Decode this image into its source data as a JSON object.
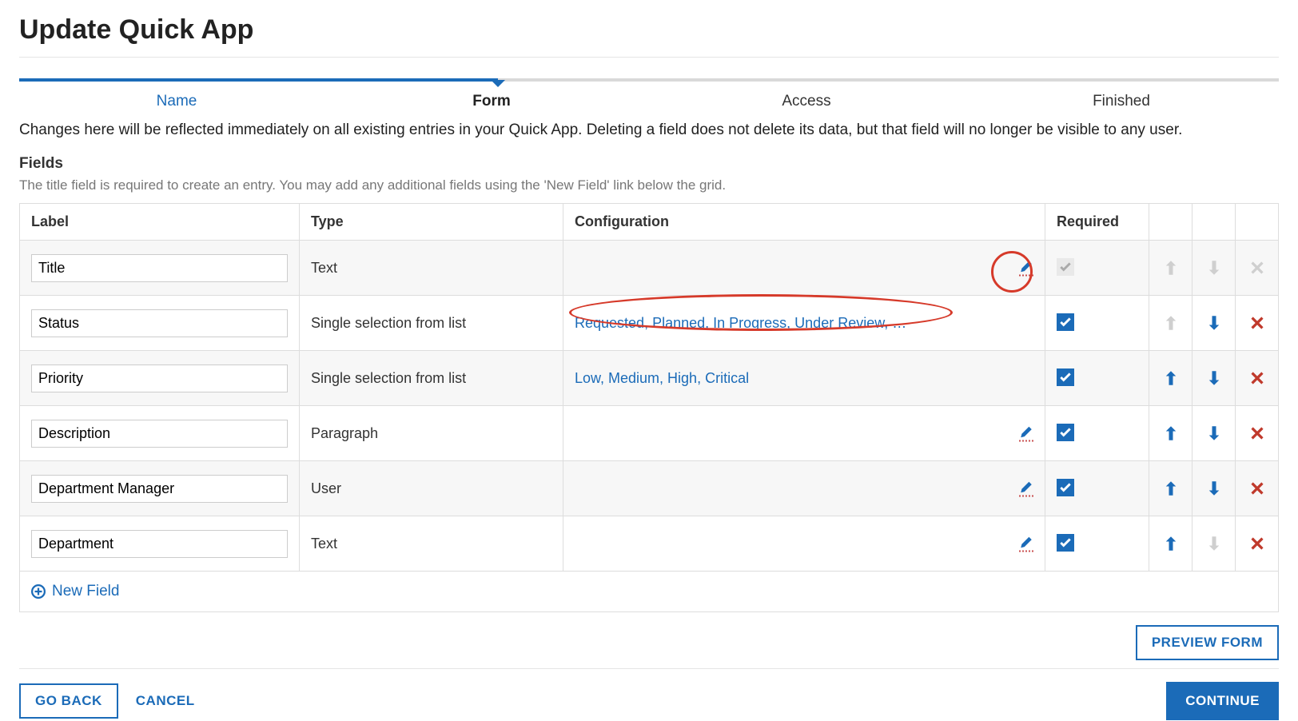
{
  "page": {
    "title": "Update Quick App",
    "intro": "Changes here will be reflected immediately on all existing entries in your Quick App. Deleting a field does not delete its data, but that field will no longer be visible to any user."
  },
  "stepper": {
    "steps": [
      "Name",
      "Form",
      "Access",
      "Finished"
    ],
    "active_index": 1
  },
  "fields_section": {
    "heading": "Fields",
    "sub": "The title field is required to create an entry. You may add any additional fields using the 'New Field' link below the grid."
  },
  "table": {
    "headers": {
      "label": "Label",
      "type": "Type",
      "config": "Configuration",
      "required": "Required"
    },
    "rows": [
      {
        "label": "Title",
        "type": "Text",
        "config_text": "",
        "has_edit_icon": true,
        "required": true,
        "required_locked": true,
        "up_enabled": false,
        "down_enabled": false,
        "delete_enabled": false,
        "highlight_circle": true
      },
      {
        "label": "Status",
        "type": "Single selection from list",
        "config_text": "Requested, Planned, In Progress, Under Review, Co…",
        "has_edit_icon": false,
        "required": true,
        "required_locked": false,
        "up_enabled": false,
        "down_enabled": true,
        "delete_enabled": true,
        "highlight_ellipse": true
      },
      {
        "label": "Priority",
        "type": "Single selection from list",
        "config_text": "Low, Medium, High, Critical",
        "has_edit_icon": false,
        "required": true,
        "required_locked": false,
        "up_enabled": true,
        "down_enabled": true,
        "delete_enabled": true
      },
      {
        "label": "Description",
        "type": "Paragraph",
        "config_text": "",
        "has_edit_icon": true,
        "required": true,
        "required_locked": false,
        "up_enabled": true,
        "down_enabled": true,
        "delete_enabled": true
      },
      {
        "label": "Department Manager",
        "type": "User",
        "config_text": "",
        "has_edit_icon": true,
        "required": true,
        "required_locked": false,
        "up_enabled": true,
        "down_enabled": true,
        "delete_enabled": true
      },
      {
        "label": "Department",
        "type": "Text",
        "config_text": "",
        "has_edit_icon": true,
        "required": true,
        "required_locked": false,
        "up_enabled": true,
        "down_enabled": false,
        "delete_enabled": true
      }
    ],
    "new_field_label": "New Field"
  },
  "buttons": {
    "preview": "PREVIEW FORM",
    "go_back": "GO BACK",
    "cancel": "CANCEL",
    "continue": "CONTINUE"
  }
}
